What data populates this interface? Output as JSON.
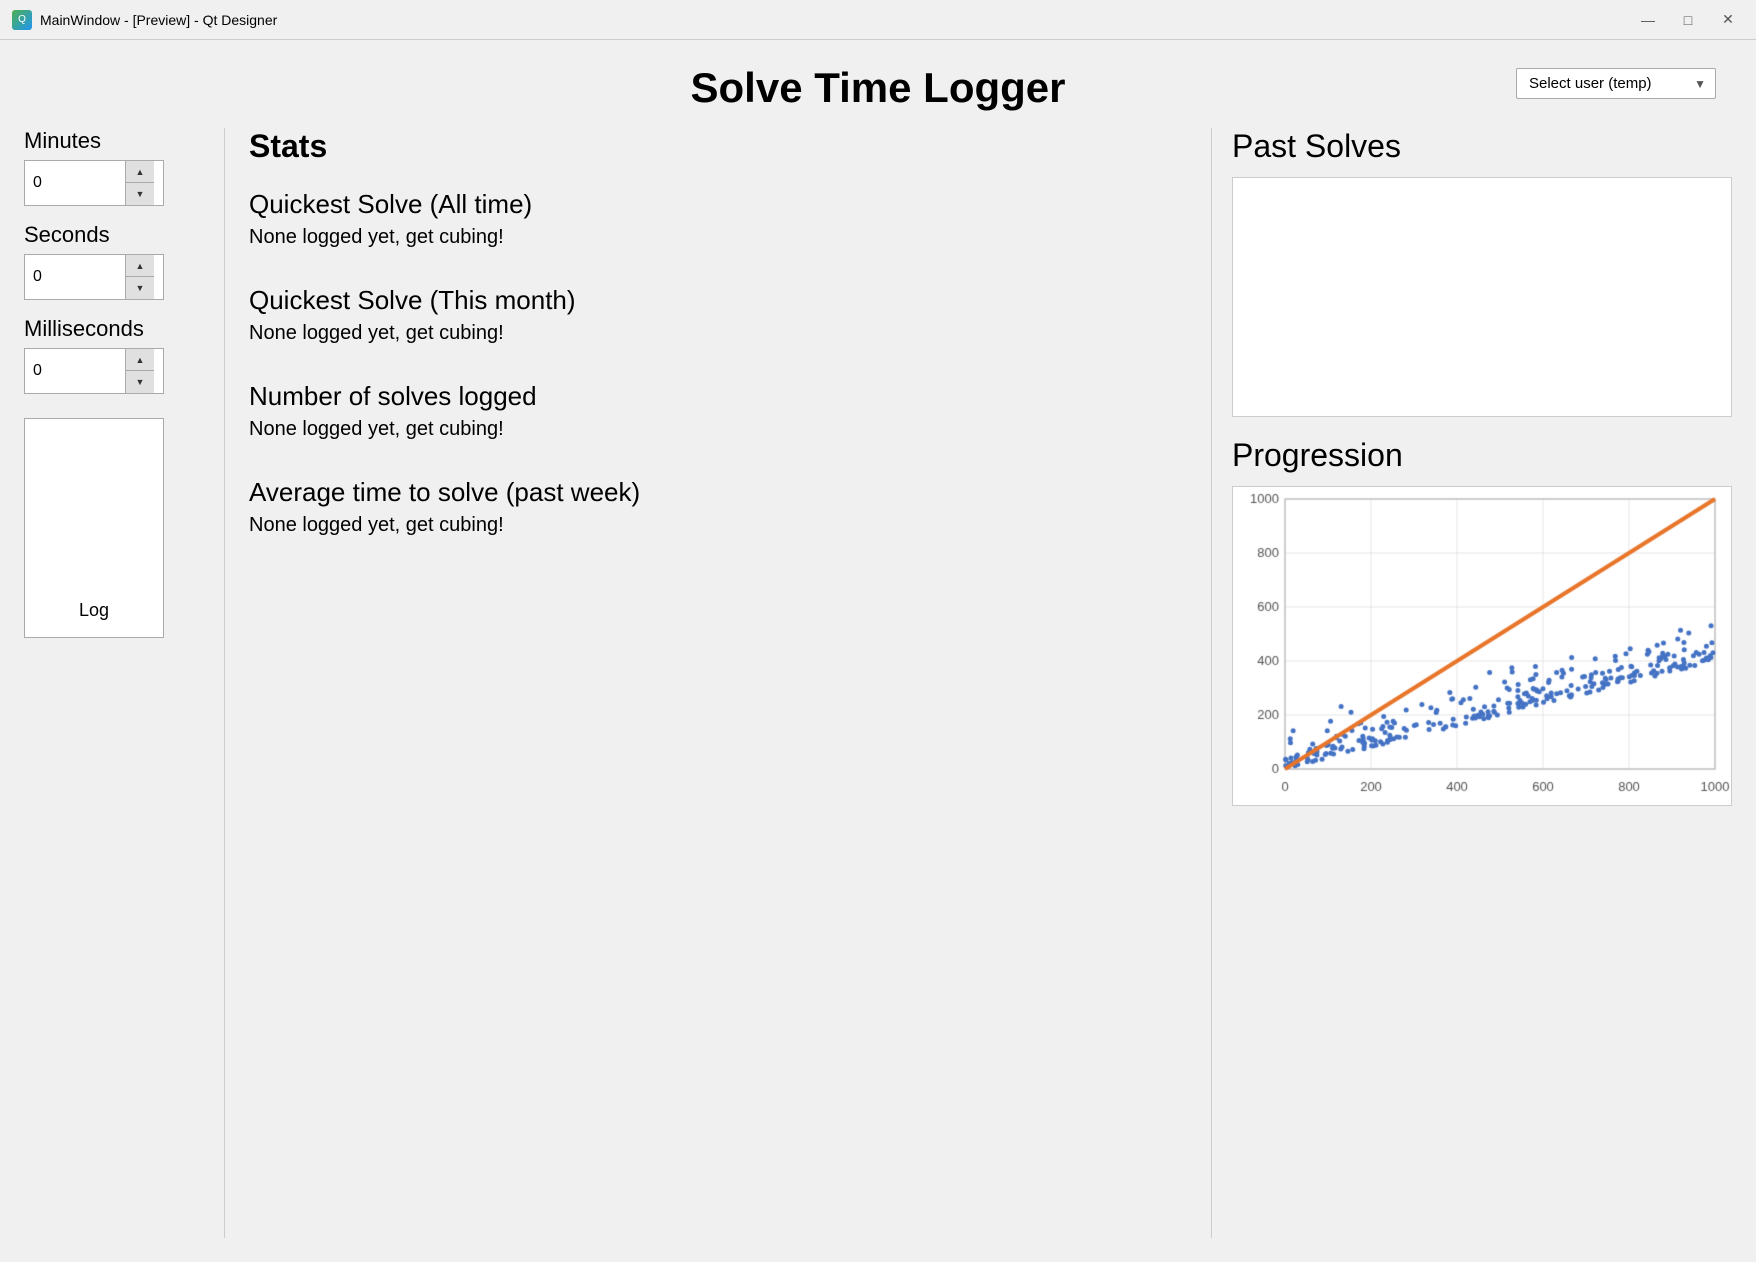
{
  "titleBar": {
    "title": "MainWindow - [Preview] - Qt Designer",
    "iconLabel": "Q",
    "minimizeLabel": "—",
    "maximizeLabel": "□",
    "closeLabel": "✕"
  },
  "header": {
    "appTitle": "Solve Time Logger",
    "userSelect": {
      "placeholder": "Select user (temp)",
      "options": [
        "Select user (temp)"
      ]
    }
  },
  "leftPanel": {
    "minutesLabel": "Minutes",
    "minutesValue": "0",
    "secondsLabel": "Seconds",
    "secondsValue": "0",
    "millisLabel": "Milliseconds",
    "millisValue": "0",
    "logButtonLabel": "Log"
  },
  "middlePanel": {
    "statsTitle": "Stats",
    "stats": [
      {
        "heading": "Quickest Solve (All time)",
        "value": "None logged yet, get cubing!"
      },
      {
        "heading": "Quickest Solve (This month)",
        "value": "None logged yet, get cubing!"
      },
      {
        "heading": "Number of solves logged",
        "value": "None logged yet, get cubing!"
      },
      {
        "heading": "Average time to solve (past week)",
        "value": "None logged yet, get cubing!"
      }
    ]
  },
  "rightPanel": {
    "pastSolvesTitle": "Past Solves",
    "progressionTitle": "Progression",
    "chart": {
      "xMax": 1000,
      "yMax": 1000,
      "xTicks": [
        0,
        200,
        400,
        600,
        800,
        1000
      ],
      "yTicks": [
        0,
        200,
        400,
        600,
        800,
        1000
      ],
      "dotColor": "#4472C4",
      "lineColor": "#E8752A",
      "accentColor": "#E8752A"
    }
  }
}
